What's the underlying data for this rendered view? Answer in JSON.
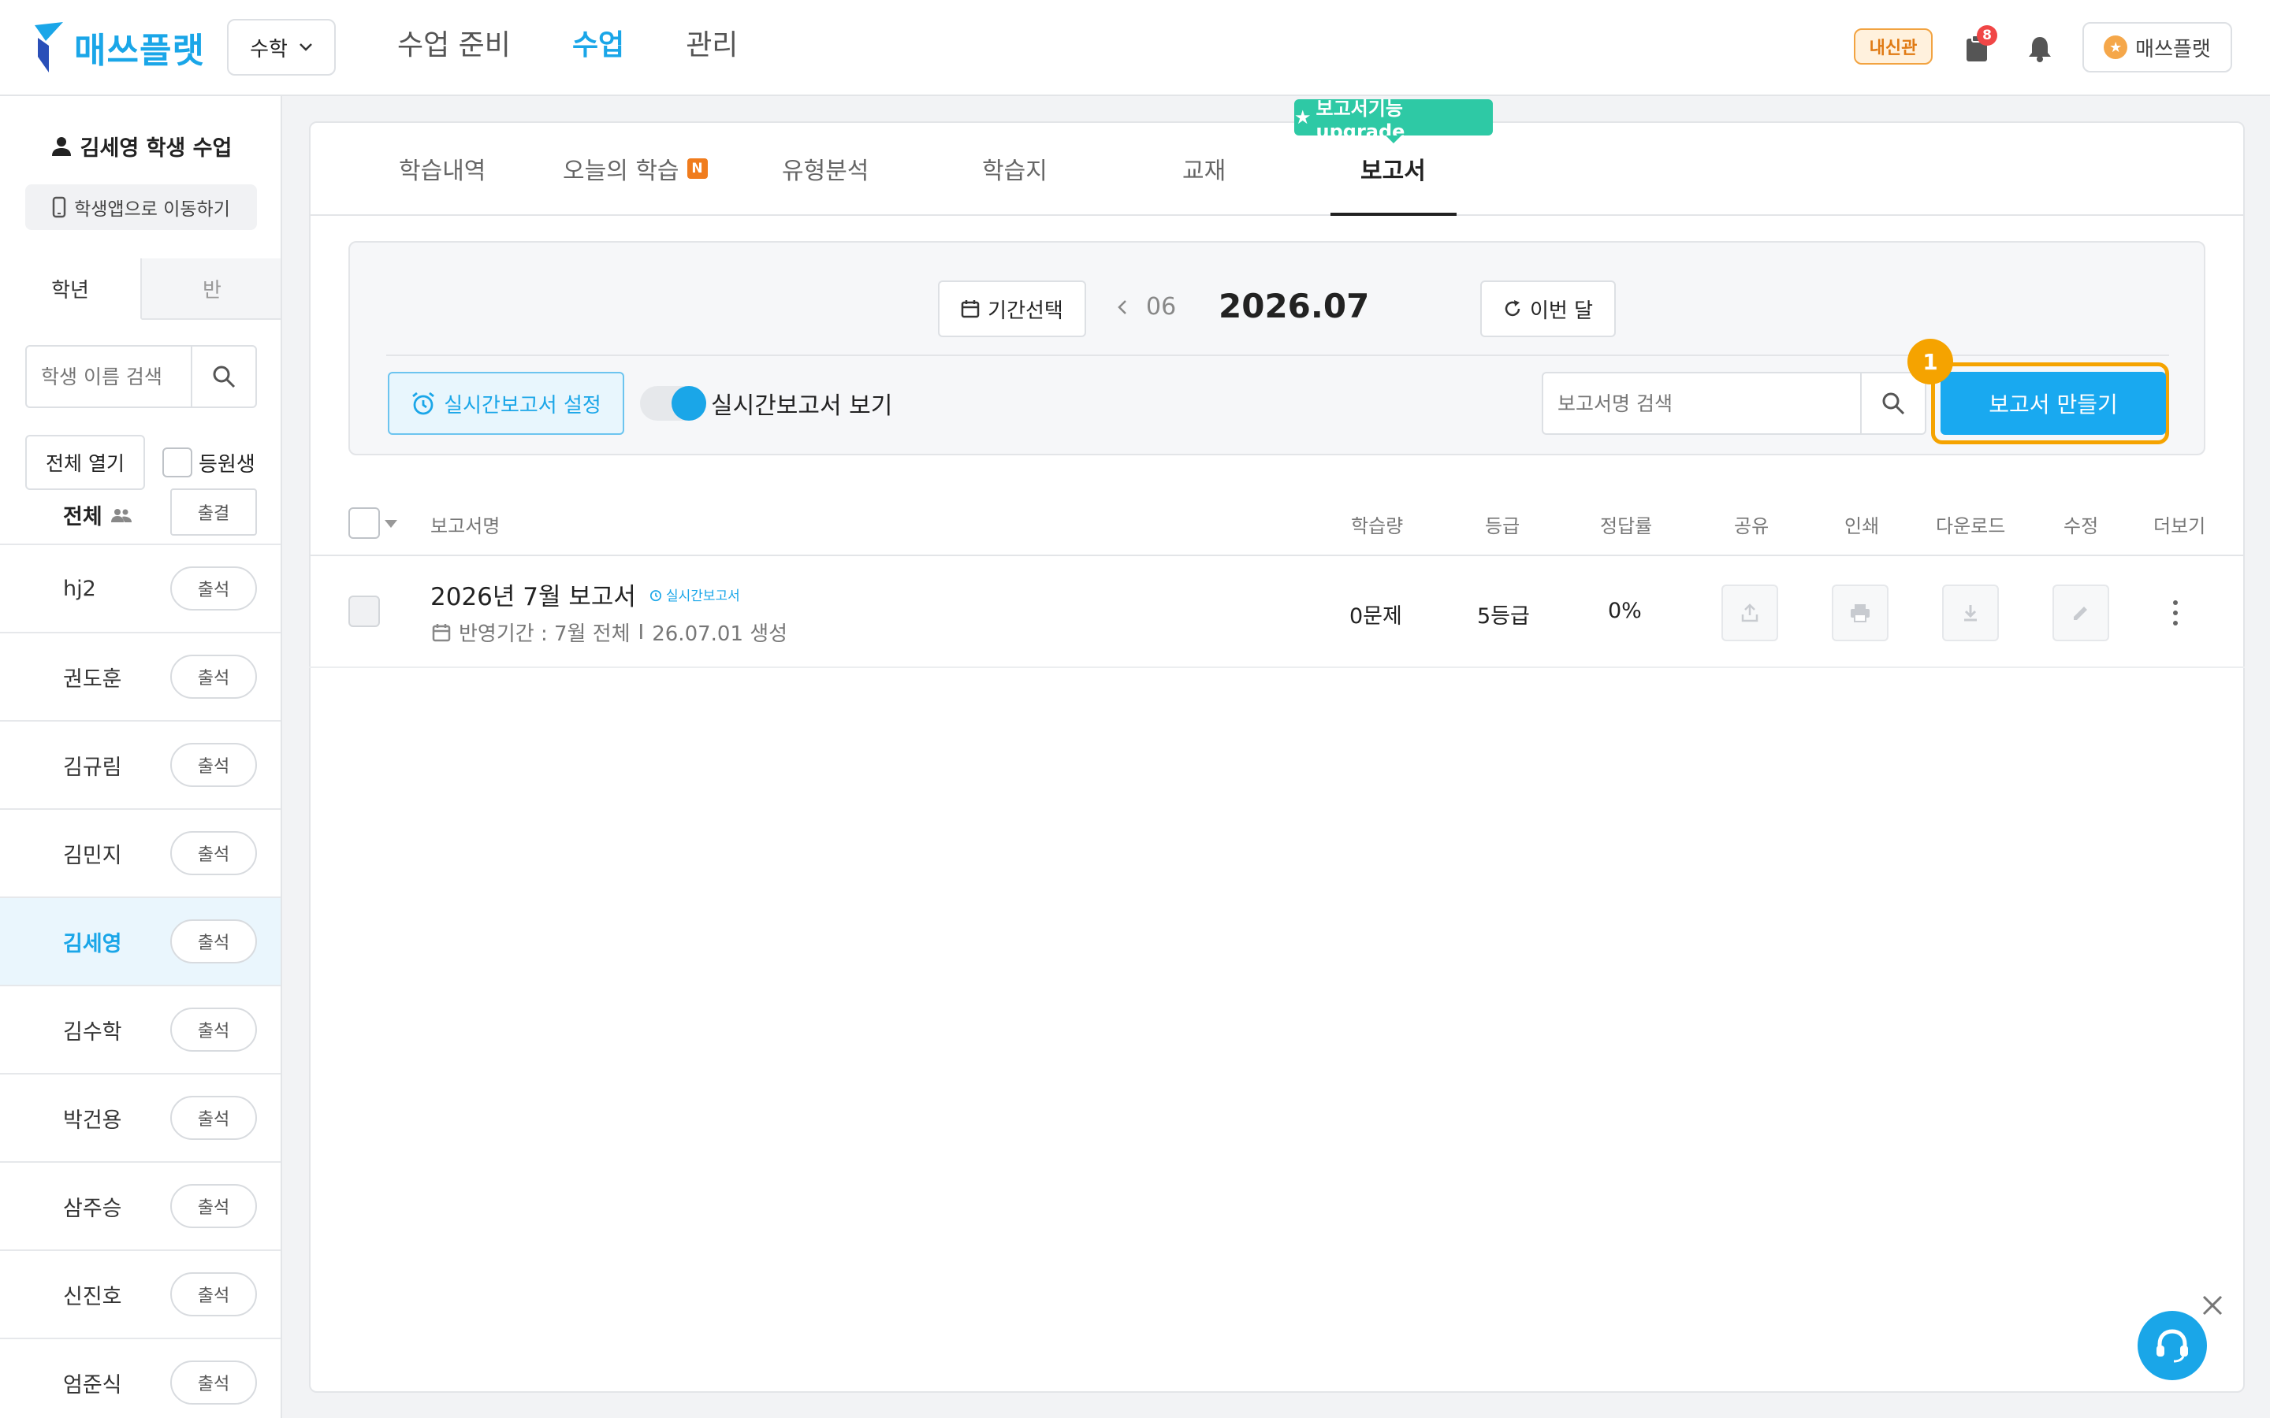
{
  "header": {
    "logo_text": "매쓰플랫",
    "subject": "수학",
    "nav": [
      {
        "label": "수업 준비",
        "active": false
      },
      {
        "label": "수업",
        "active": true
      },
      {
        "label": "관리",
        "active": false
      }
    ],
    "naesin_label": "내신관",
    "notification_count": "8",
    "user_label": "매쓰플랫"
  },
  "sidebar": {
    "class_title": "김세영 학생 수업",
    "app_button": "학생앱으로 이동하기",
    "tabs": [
      "학년",
      "반"
    ],
    "search_placeholder": "학생 이름 검색",
    "open_all": "전체 열기",
    "enrolled_label": "등원생",
    "all_label": "전체",
    "all_attendance": "출결",
    "students": [
      {
        "name": "hj2",
        "attendance": "출석",
        "selected": false
      },
      {
        "name": "권도훈",
        "attendance": "출석",
        "selected": false
      },
      {
        "name": "김규림",
        "attendance": "출석",
        "selected": false
      },
      {
        "name": "김민지",
        "attendance": "출석",
        "selected": false
      },
      {
        "name": "김세영",
        "attendance": "출석",
        "selected": true
      },
      {
        "name": "김수학",
        "attendance": "출석",
        "selected": false
      },
      {
        "name": "박건용",
        "attendance": "출석",
        "selected": false
      },
      {
        "name": "삼주승",
        "attendance": "출석",
        "selected": false
      },
      {
        "name": "신진호",
        "attendance": "출석",
        "selected": false
      },
      {
        "name": "엄준식",
        "attendance": "출석",
        "selected": false
      }
    ]
  },
  "main": {
    "tabs": [
      {
        "label": "학습내역"
      },
      {
        "label": "오늘의 학습",
        "badge": "N"
      },
      {
        "label": "유형분석"
      },
      {
        "label": "학습지"
      },
      {
        "label": "교재"
      },
      {
        "label": "보고서",
        "active": true
      }
    ],
    "upgrade_tag": "보고서기능 upgrade",
    "filter": {
      "period_button": "기간선택",
      "prev_month": "06",
      "current_month": "2026.07",
      "this_month_button": "이번 달",
      "realtime_setting": "실시간보고서 설정",
      "realtime_view": "실시간보고서 보기",
      "search_placeholder": "보고서명 검색",
      "create_button": "보고서 만들기",
      "step_number": "1"
    },
    "table": {
      "columns": [
        "보고서명",
        "학습량",
        "등급",
        "정답률",
        "공유",
        "인쇄",
        "다운로드",
        "수정",
        "더보기"
      ],
      "rows": [
        {
          "title": "2026년 7월 보고서",
          "tag": "실시간보고서",
          "meta_period": "반영기간 : 7월 전체",
          "meta_sep": "I",
          "meta_created": "26.07.01 생성",
          "amount": "0문제",
          "grade": "5등급",
          "accuracy": "0%"
        }
      ]
    }
  },
  "colors": {
    "accent": "#1aa6e8",
    "highlight": "#f5a300",
    "upgrade": "#2ec9a5",
    "badge": "#f04646"
  }
}
